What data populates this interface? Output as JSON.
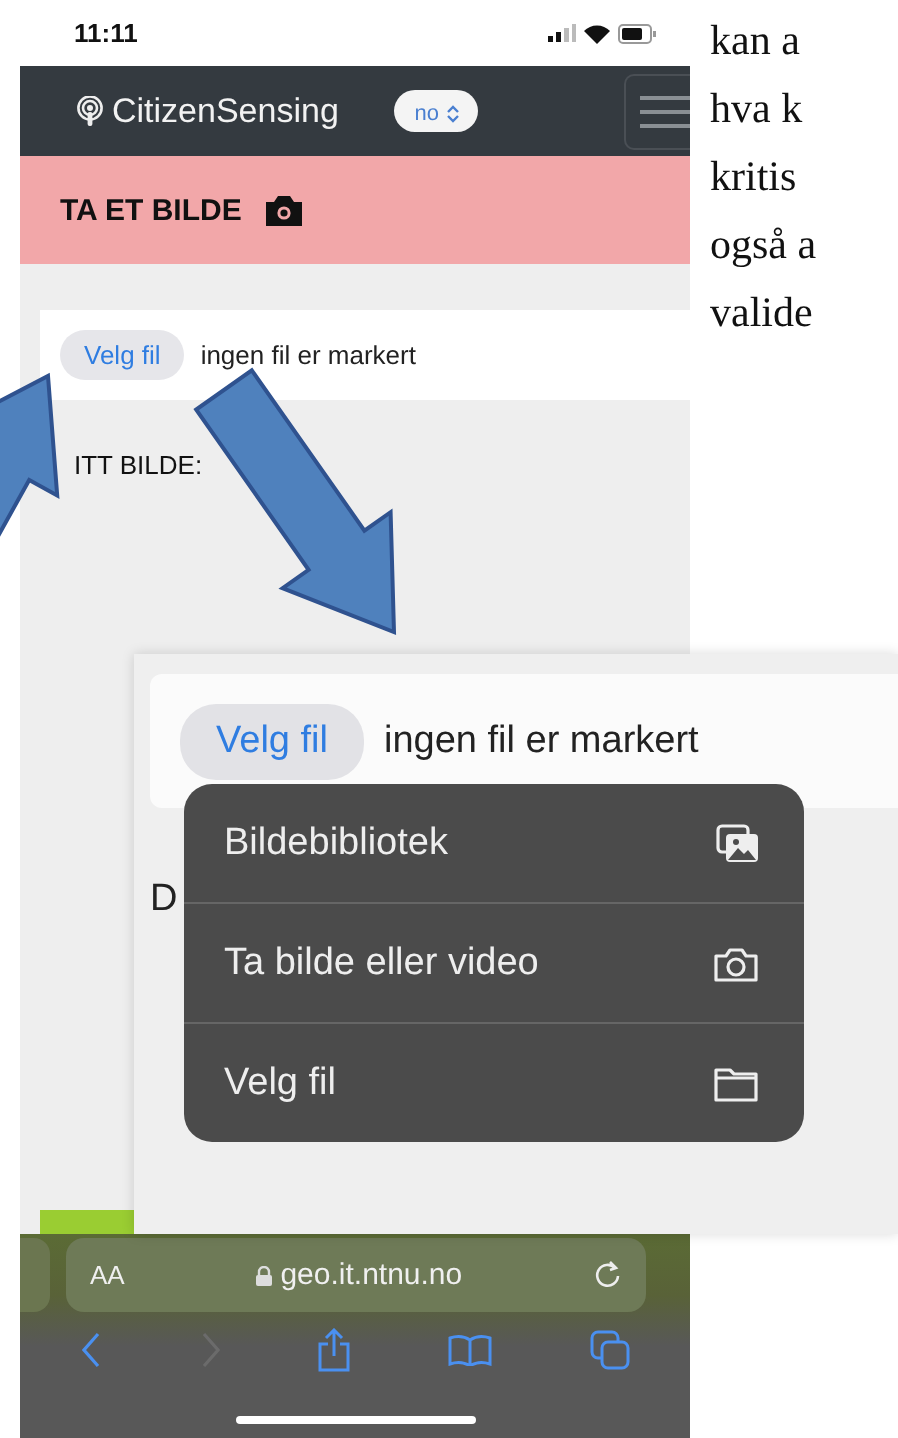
{
  "status_bar": {
    "time": "11:11"
  },
  "navbar": {
    "brand": "CitizenSensing",
    "language": "no"
  },
  "header": {
    "title": "TA ET BILDE"
  },
  "file_input": {
    "button": "Velg fil",
    "status": "ingen fil er markert"
  },
  "section_label": "ITT BILDE:",
  "browser_bar": {
    "text_size": "AA",
    "address": "geo.it.ntnu.no",
    "back_disabled": false,
    "forward_disabled": true
  },
  "zoom_inset": {
    "file_input": {
      "button": "Velg fil",
      "status": "ingen fil er markert"
    },
    "covered_label": "D",
    "menu": [
      {
        "label": "Bildebibliotek",
        "kind": "photos"
      },
      {
        "label": "Ta bilde eller video",
        "kind": "camera"
      },
      {
        "label": "Velg fil",
        "kind": "folder"
      }
    ]
  },
  "document_text": [
    "kan a",
    "hva k",
    "kritis",
    "også a",
    "valide"
  ]
}
